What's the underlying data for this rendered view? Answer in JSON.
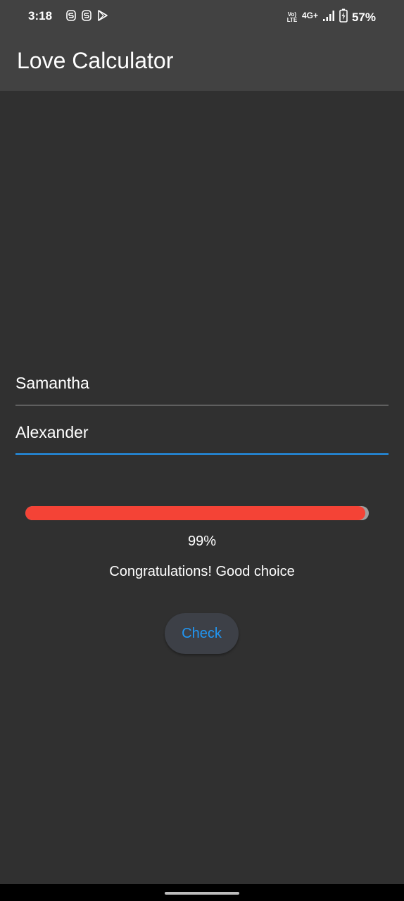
{
  "status_bar": {
    "time": "3:18",
    "left_icons": [
      "s-app-icon",
      "s-app-icon",
      "play-store-icon"
    ],
    "volte_top": "Vo)",
    "volte_bottom": "LTE",
    "network": "4G+",
    "battery_percent": "57%"
  },
  "app_bar": {
    "title": "Love Calculator"
  },
  "form": {
    "name1_value": "Samantha",
    "name2_value": "Alexander"
  },
  "result": {
    "progress_fraction": 0.99,
    "percent_text": "99%",
    "message": "Congratulations! Good choice"
  },
  "actions": {
    "check_label": "Check"
  },
  "colors": {
    "background": "#303030",
    "app_bar": "#424242",
    "accent": "#2196f3",
    "progress_fill": "#f44336",
    "progress_track": "#9e9e9e"
  }
}
